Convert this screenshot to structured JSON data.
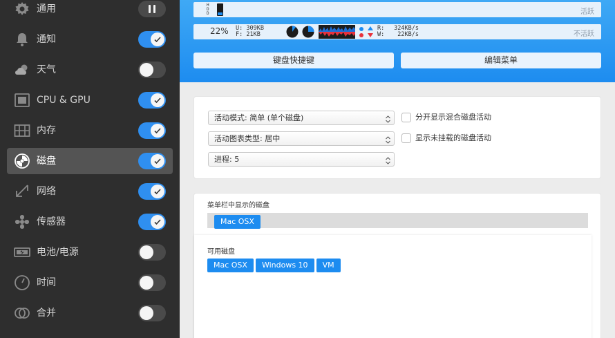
{
  "sidebar": {
    "items": [
      {
        "label": "通用",
        "control": "pause"
      },
      {
        "label": "通知",
        "control": "on"
      },
      {
        "label": "天气",
        "control": "off"
      },
      {
        "label": "CPU & GPU",
        "control": "on"
      },
      {
        "label": "内存",
        "control": "on"
      },
      {
        "label": "磁盘",
        "control": "on",
        "active": true
      },
      {
        "label": "网络",
        "control": "on"
      },
      {
        "label": "传感器",
        "control": "on"
      },
      {
        "label": "电池/电源",
        "control": "off"
      },
      {
        "label": "时间",
        "control": "off"
      },
      {
        "label": "合并",
        "control": "off"
      }
    ]
  },
  "header": {
    "preview_active": {
      "vertical_label": "HDD",
      "status": "活跃"
    },
    "preview_inactive": {
      "percent": "22%",
      "used": "U: 309KB",
      "free": "F: 21KB",
      "read_label": "R:",
      "read_value": "324KB/s",
      "write_label": "W:",
      "write_value": "22KB/s",
      "status": "不活跃"
    },
    "shortcut_button": "键盘快捷键",
    "edit_menu_button": "编辑菜单"
  },
  "settings": {
    "mode_select": "活动模式: 简单 (单个磁盘)",
    "graph_select": "活动图表类型: 居中",
    "process_select": "进程:  5",
    "split_checkbox": "分开显示混合磁盘活动",
    "unmounted_checkbox": "显示未挂载的磁盘活动"
  },
  "disks": {
    "menubar_title": "菜单栏中显示的磁盘",
    "menubar_disks": [
      "Mac OSX"
    ],
    "available_title": "可用磁盘",
    "available_disks": [
      "Mac OSX",
      "Windows 10",
      "VM"
    ]
  },
  "colors": {
    "accent": "#1d8cf0",
    "sidebar_bg": "#2e2e2e",
    "sidebar_active": "#545454",
    "graph_read": "#1f6fd6",
    "graph_write": "#e8323c"
  }
}
